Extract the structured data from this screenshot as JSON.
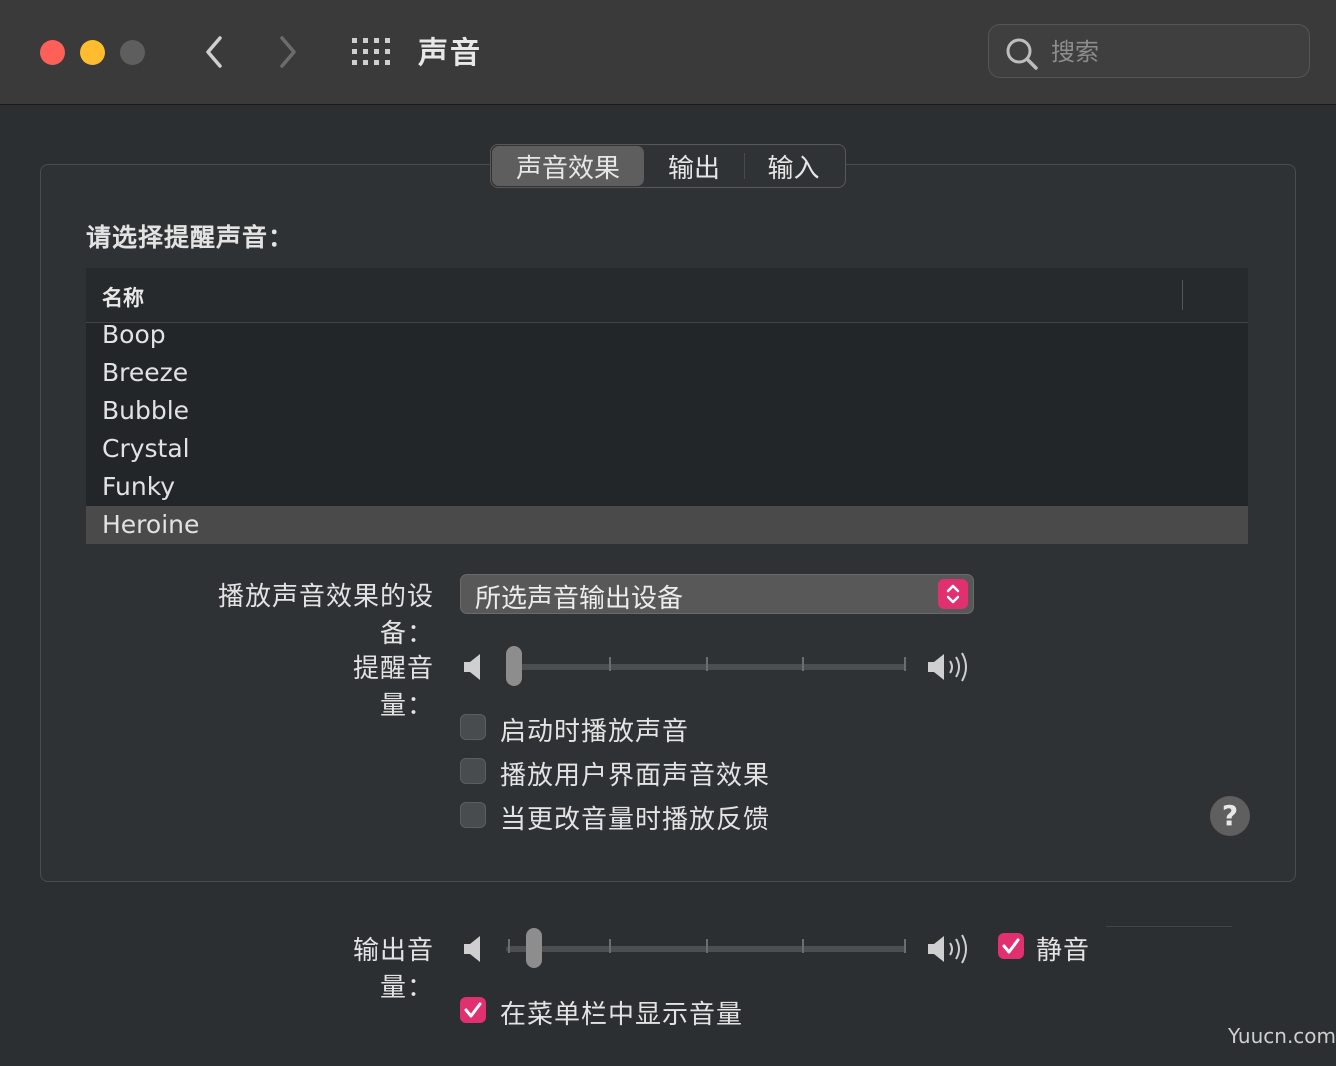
{
  "window": {
    "title": "声音",
    "search_placeholder": "搜索"
  },
  "tabs": [
    "声音效果",
    "输出",
    "输入"
  ],
  "alert": {
    "prompt": "请选择提醒声音：",
    "column_header": "名称",
    "sounds": [
      "Boop",
      "Breeze",
      "Bubble",
      "Crystal",
      "Funky",
      "Heroine"
    ],
    "selected": "Heroine"
  },
  "device": {
    "label": "播放声音效果的设备：",
    "value": "所选声音输出设备"
  },
  "alert_volume": {
    "label": "提醒音量：",
    "level": 0.02
  },
  "options": [
    {
      "label": "启动时播放声音",
      "checked": false
    },
    {
      "label": "播放用户界面声音效果",
      "checked": false
    },
    {
      "label": "当更改音量时播放反馈",
      "checked": false
    }
  ],
  "help_label": "?",
  "output_volume": {
    "label": "输出音量：",
    "level": 0.07,
    "mute_label": "静音",
    "muted": true
  },
  "menubar_option": {
    "label": "在菜单栏中显示音量",
    "checked": true
  },
  "watermark": "Yuucn.com",
  "colors": {
    "accent": "#e0306f",
    "selection": "#4a4a4a"
  }
}
